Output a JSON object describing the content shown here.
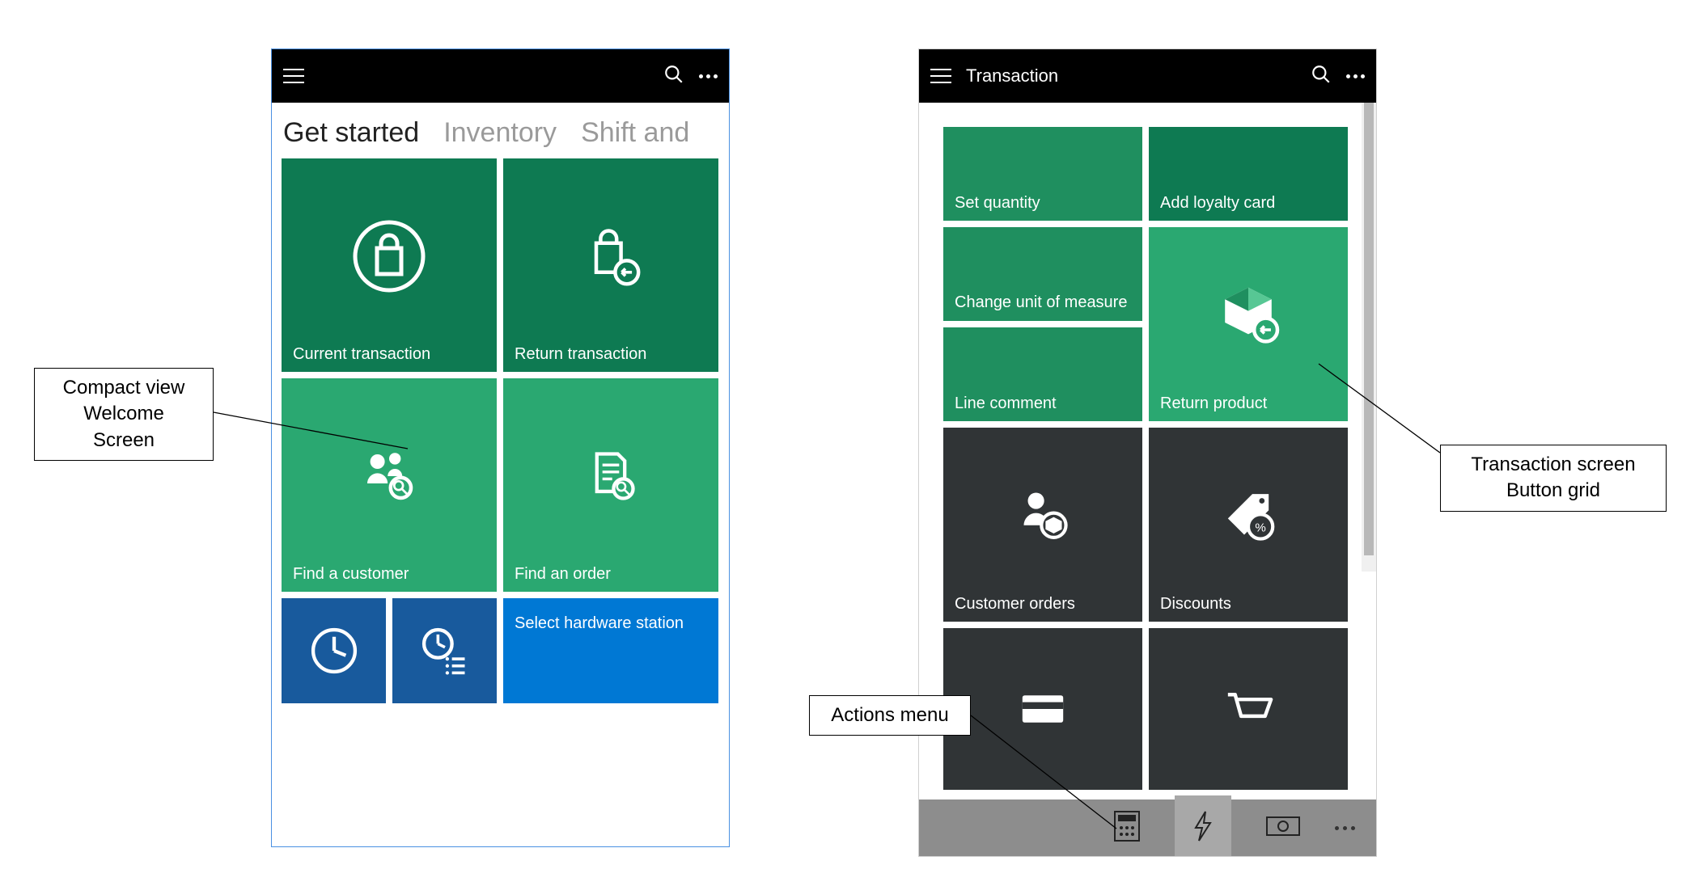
{
  "callouts": {
    "welcome": "Compact view\nWelcome\nScreen",
    "buttongrid": "Transaction screen\nButton grid",
    "actions": "Actions menu"
  },
  "left": {
    "tabs": {
      "active": "Get started",
      "t1": "Inventory",
      "t2": "Shift and"
    },
    "tiles": {
      "current_tx": "Current transaction",
      "return_tx": "Return transaction",
      "find_cust": "Find a customer",
      "find_order": "Find an order",
      "select_hw": "Select hardware station"
    }
  },
  "right": {
    "title": "Transaction",
    "tiles": {
      "set_qty": "Set quantity",
      "add_loyalty": "Add loyalty card",
      "change_uom": "Change unit of measure",
      "line_comment": "Line comment",
      "return_prod": "Return product",
      "cust_orders": "Customer orders",
      "discounts": "Discounts"
    }
  }
}
